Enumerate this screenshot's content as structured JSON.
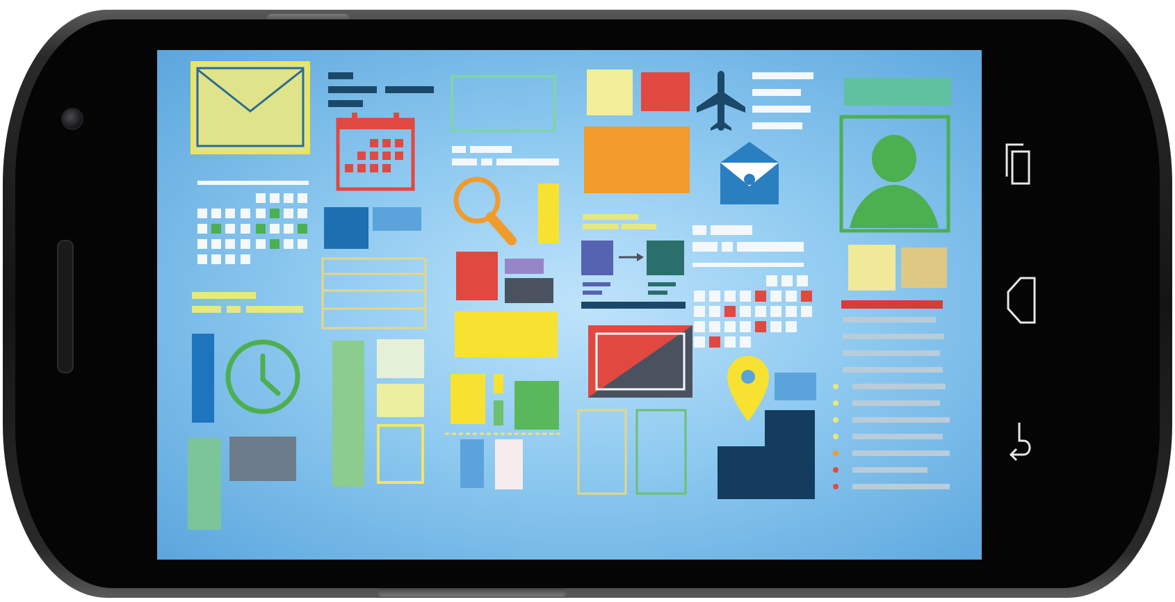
{
  "device": {
    "model": "android-phone-landscape"
  },
  "screen": {
    "wallpaper": "flat-ui-icon-collage"
  },
  "navigation_bar": {
    "buttons": [
      {
        "name": "recent-apps",
        "icon": "recent-apps-icon"
      },
      {
        "name": "home",
        "icon": "home-icon"
      },
      {
        "name": "back",
        "icon": "back-icon"
      }
    ]
  },
  "colors": {
    "screen_bg": "#8fcaf0",
    "yellow": "#f8e231",
    "red": "#e14840",
    "orange": "#f19b2c",
    "green": "#4caf50",
    "navy": "#1b4868",
    "blue": "#2a7fc0"
  }
}
